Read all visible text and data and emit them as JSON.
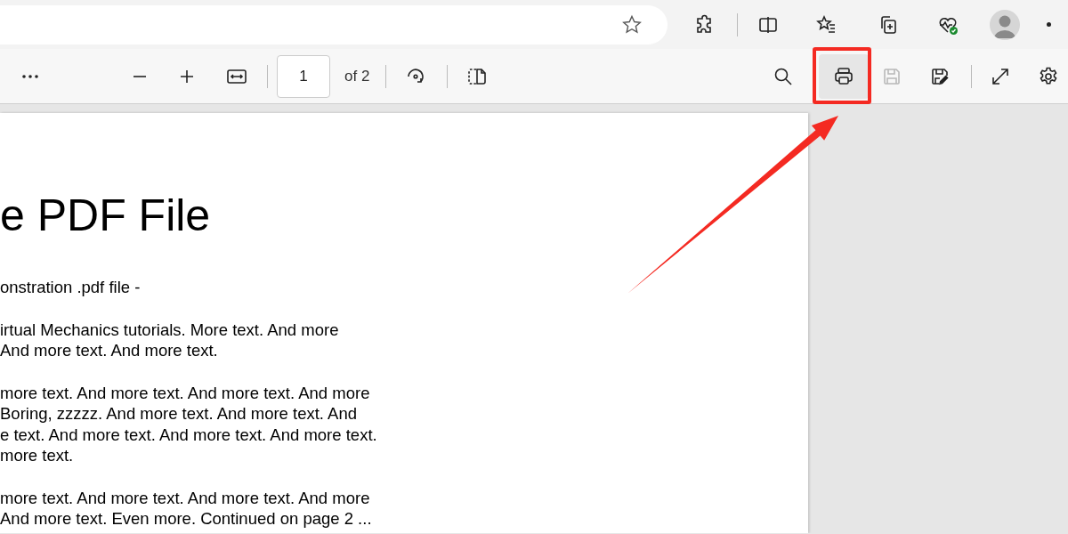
{
  "browser_toolbar": {
    "profile_status_ok": true
  },
  "pdf_toolbar": {
    "page_input": "1",
    "page_count": "of 2",
    "print_button": {
      "highlighted": true
    },
    "save_button": {
      "disabled": true
    }
  },
  "document": {
    "title": "e PDF File",
    "paragraphs": [
      [
        "onstration .pdf file -"
      ],
      [
        "irtual Mechanics tutorials. More text. And more",
        "And more text. And more text."
      ],
      [
        "more text. And more text. And more text. And more",
        "Boring, zzzzz. And more text. And more text. And",
        "e text. And more text. And more text. And more text.",
        "more text."
      ],
      [
        "more text. And more text. And more text. And more",
        "And more text. Even more. Continued on page 2 ..."
      ]
    ]
  }
}
